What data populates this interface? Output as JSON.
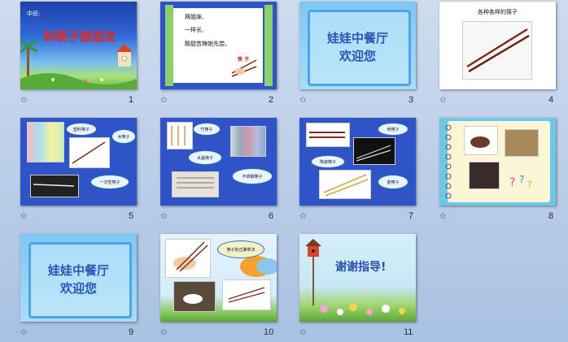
{
  "slides": [
    {
      "num": "1",
      "label": "中班:",
      "title": "和筷子做朋友"
    },
    {
      "num": "2",
      "lines": [
        "两姐妹,",
        "一样长,",
        "酸甜苦辣她先尝。"
      ],
      "tag": "筷 子"
    },
    {
      "num": "3",
      "title_l1": "娃娃中餐厅",
      "title_l2": "欢迎您"
    },
    {
      "num": "4",
      "title": "各种各样的筷子"
    },
    {
      "num": "5",
      "bubbles": [
        "塑料筷子",
        "木筷子",
        "一次性筷子"
      ]
    },
    {
      "num": "6",
      "bubbles": [
        "竹筷子",
        "水晶筷子",
        "不锈钢筷子"
      ]
    },
    {
      "num": "7",
      "bubbles": [
        "骨筷子",
        "陶瓷筷子",
        "金筷子"
      ]
    },
    {
      "num": "8"
    },
    {
      "num": "9",
      "title_l1": "娃娃中餐厅",
      "title_l2": "欢迎您"
    },
    {
      "num": "10",
      "bubble": "筷子的正确拿法"
    },
    {
      "num": "11",
      "title": "谢谢指导!"
    }
  ],
  "star_glyph": "✩"
}
